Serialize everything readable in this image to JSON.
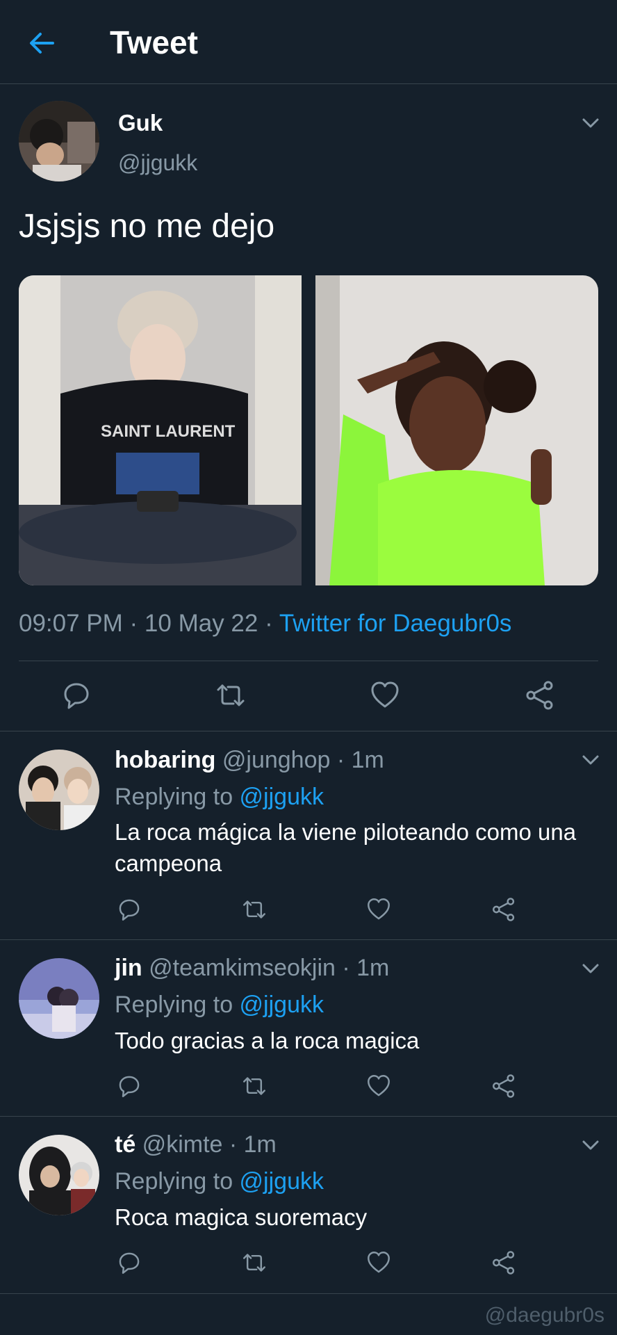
{
  "header": {
    "title": "Tweet",
    "back_icon": "arrow-left-icon",
    "accent": "#1da1f2"
  },
  "tweet": {
    "name": "Guk",
    "handle": "@jjgukk",
    "text": "Jsjsjs no me dejo",
    "meta_time": "09:07 PM · 10 May 22 · ",
    "meta_source": "Twitter for Daegubr0s",
    "media_left_caption": "SAINT LAURENT"
  },
  "replies": [
    {
      "name": "hobaring",
      "handle_time": " @junghop · 1m",
      "replying_label": "Replying to ",
      "replying_to": "@jjgukk",
      "text": "La roca mágica la viene piloteando como una campeona"
    },
    {
      "name": "jin",
      "handle_time": " @teamkimseokjin · 1m",
      "replying_label": "Replying to ",
      "replying_to": "@jjgukk",
      "text": "Todo gracias a la roca magica"
    },
    {
      "name": "té",
      "handle_time": " @kimte · 1m",
      "replying_label": "Replying to ",
      "replying_to": "@jjgukk",
      "text": "Roca magica suoremacy"
    }
  ],
  "watermark": "@daegubr0s",
  "colors": {
    "background": "#15202b",
    "secondary_text": "#8899a6",
    "border": "#38444d"
  }
}
